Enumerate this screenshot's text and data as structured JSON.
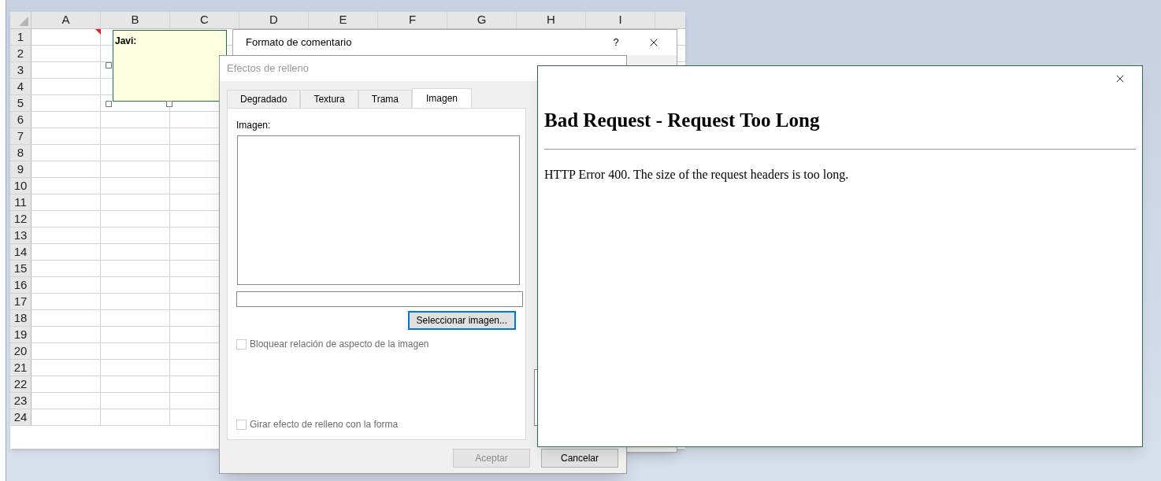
{
  "spreadsheet": {
    "columns": [
      "A",
      "B",
      "C",
      "D",
      "E",
      "F",
      "G",
      "H",
      "I"
    ],
    "rows": [
      "1",
      "2",
      "3",
      "4",
      "5",
      "6",
      "7",
      "8",
      "9",
      "10",
      "11",
      "12",
      "13",
      "14",
      "15",
      "16",
      "17",
      "18",
      "19",
      "20",
      "21",
      "22",
      "23",
      "24"
    ],
    "comment": {
      "author": "Javi:"
    }
  },
  "comment_dialog": {
    "title": "Formato de comentario",
    "help": "?"
  },
  "fill_dialog": {
    "title": "Efectos de relleno",
    "active": false,
    "tabs": [
      {
        "label": "Degradado",
        "selected": false
      },
      {
        "label": "Textura",
        "selected": false
      },
      {
        "label": "Trama",
        "selected": false
      },
      {
        "label": "Imagen",
        "selected": true
      }
    ],
    "image_label": "Imagen:",
    "select_button": {
      "label": "Seleccionar imagen...",
      "focused": true
    },
    "checkboxes": [
      {
        "label": "Bloquear relación de aspecto de la imagen",
        "checked": false,
        "disabled": true
      },
      {
        "label": "Girar efecto de relleno con la forma",
        "checked": false,
        "disabled": true
      }
    ],
    "buttons": [
      {
        "label": "Aceptar",
        "disabled": true
      },
      {
        "label": "Cancelar",
        "disabled": false
      }
    ]
  },
  "error_window": {
    "heading": "Bad Request - Request Too Long",
    "message": "HTTP Error 400. The size of the request headers is too long."
  }
}
